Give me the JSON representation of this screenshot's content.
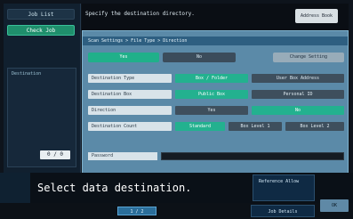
{
  "header": {
    "title": "Specify the destination directory.",
    "top_button": "Address Book"
  },
  "left_panel": {
    "btn1": "Job List",
    "btn2": "Check Job",
    "side_list_title": "Destination",
    "counter": "0 / 0"
  },
  "dialog": {
    "breadcrumb": "Scan Settings > File Type > Direction",
    "tabs": {
      "on": "Yes",
      "off": "No",
      "right": "Change Setting"
    },
    "rows": [
      {
        "label": "Destination Type",
        "opt1": "Box / Folder",
        "opt2": "User Box Address"
      },
      {
        "label": "Destination Box",
        "opt1": "Public Box",
        "opt2": "Personal ID"
      },
      {
        "label": "Direction",
        "opt1": "Yes",
        "opt2": "No"
      },
      {
        "label": "Destination Count",
        "opt1": "Standard",
        "opt2": "Box Level 1",
        "opt3": "Box Level 2"
      }
    ],
    "name_label": "Password"
  },
  "message": {
    "text": "Select data destination.",
    "right_top": "Reference Allow"
  },
  "footer": {
    "mini": "1 / 2",
    "right": "Job Details",
    "corner": "OK"
  }
}
